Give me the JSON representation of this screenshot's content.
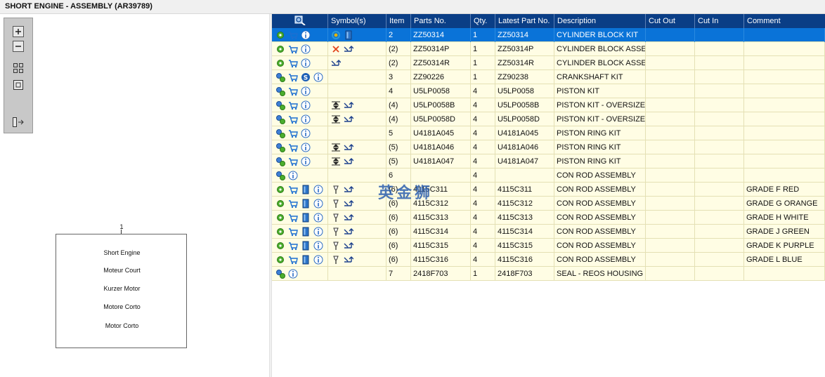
{
  "title": "SHORT ENGINE - ASSEMBLY (AR39789)",
  "diagram": {
    "callout": "1",
    "lines": [
      "Short Engine",
      "Moteur Court",
      "Kurzer Motor",
      "Motore Corto",
      "Motor Corto"
    ]
  },
  "toolbox": {
    "buttons": [
      "zoom-in",
      "zoom-out",
      "fit-all",
      "fit-page",
      "toggle-layout"
    ]
  },
  "table": {
    "headers": [
      "",
      "Symbol(s)",
      "Item",
      "Parts No.",
      "Qty.",
      "Latest Part No.",
      "Description",
      "Cut Out",
      "Cut In",
      "Comment"
    ],
    "rows": [
      {
        "icons": [
          "gear",
          "cart",
          "info"
        ],
        "symbols": [
          "gear-arrows",
          "book"
        ],
        "item": "2",
        "part": "ZZ50314",
        "qty": "1",
        "latest": "ZZ50314",
        "desc": "CYLINDER BLOCK KIT",
        "cutout": "",
        "cutin": "",
        "comment": ""
      },
      {
        "icons": [
          "gear",
          "cart",
          "info"
        ],
        "symbols": [
          "x",
          "replace"
        ],
        "item": "(2)",
        "part": "ZZ50314P",
        "qty": "1",
        "latest": "ZZ50314P",
        "desc": "CYLINDER BLOCK ASSEMBLY",
        "cutout": "",
        "cutin": "",
        "comment": ""
      },
      {
        "icons": [
          "gear",
          "cart",
          "info"
        ],
        "symbols": [
          "replace"
        ],
        "item": "(2)",
        "part": "ZZ50314R",
        "qty": "1",
        "latest": "ZZ50314R",
        "desc": "CYLINDER BLOCK ASSEMBLY",
        "cutout": "",
        "cutin": "",
        "comment": ""
      },
      {
        "icons": [
          "gears",
          "cart",
          "s",
          "info"
        ],
        "symbols": [],
        "item": "3",
        "part": "ZZ90226",
        "qty": "1",
        "latest": "ZZ90238",
        "desc": "CRANKSHAFT KIT",
        "cutout": "",
        "cutin": "",
        "comment": ""
      },
      {
        "icons": [
          "gears",
          "cart",
          "info"
        ],
        "symbols": [],
        "item": "4",
        "part": "U5LP0058",
        "qty": "4",
        "latest": "U5LP0058",
        "desc": "PISTON KIT",
        "cutout": "",
        "cutin": "",
        "comment": ""
      },
      {
        "icons": [
          "gears",
          "cart",
          "info"
        ],
        "symbols": [
          "oversize",
          "replace"
        ],
        "item": "(4)",
        "part": "U5LP0058B",
        "qty": "4",
        "latest": "U5LP0058B",
        "desc": "PISTON KIT - OVERSIZE",
        "cutout": "",
        "cutin": "",
        "comment": ""
      },
      {
        "icons": [
          "gears",
          "cart",
          "info"
        ],
        "symbols": [
          "oversize",
          "replace"
        ],
        "item": "(4)",
        "part": "U5LP0058D",
        "qty": "4",
        "latest": "U5LP0058D",
        "desc": "PISTON KIT - OVERSIZE",
        "cutout": "",
        "cutin": "",
        "comment": ""
      },
      {
        "icons": [
          "gears",
          "cart",
          "info"
        ],
        "symbols": [],
        "item": "5",
        "part": "U4181A045",
        "qty": "4",
        "latest": "U4181A045",
        "desc": "PISTON RING KIT",
        "cutout": "",
        "cutin": "",
        "comment": ""
      },
      {
        "icons": [
          "gears",
          "cart",
          "info"
        ],
        "symbols": [
          "oversize",
          "replace"
        ],
        "item": "(5)",
        "part": "U4181A046",
        "qty": "4",
        "latest": "U4181A046",
        "desc": "PISTON RING KIT",
        "cutout": "",
        "cutin": "",
        "comment": ""
      },
      {
        "icons": [
          "gears",
          "cart",
          "info"
        ],
        "symbols": [
          "oversize",
          "replace"
        ],
        "item": "(5)",
        "part": "U4181A047",
        "qty": "4",
        "latest": "U4181A047",
        "desc": "PISTON RING KIT",
        "cutout": "",
        "cutin": "",
        "comment": ""
      },
      {
        "icons": [
          "gears",
          "info"
        ],
        "symbols": [],
        "item": "6",
        "part": "",
        "qty": "4",
        "latest": "",
        "desc": "CON ROD ASSEMBLY",
        "cutout": "",
        "cutin": "",
        "comment": ""
      },
      {
        "icons": [
          "gear",
          "cart",
          "book",
          "info"
        ],
        "symbols": [
          "pin",
          "replace"
        ],
        "item": "(6)",
        "part": "4115C311",
        "qty": "4",
        "latest": "4115C311",
        "desc": "CON ROD ASSEMBLY",
        "cutout": "",
        "cutin": "",
        "comment": "GRADE F  RED"
      },
      {
        "icons": [
          "gear",
          "cart",
          "book",
          "info"
        ],
        "symbols": [
          "pin",
          "replace"
        ],
        "item": "(6)",
        "part": "4115C312",
        "qty": "4",
        "latest": "4115C312",
        "desc": "CON ROD ASSEMBLY",
        "cutout": "",
        "cutin": "",
        "comment": "GRADE G  ORANGE"
      },
      {
        "icons": [
          "gear",
          "cart",
          "book",
          "info"
        ],
        "symbols": [
          "pin",
          "replace"
        ],
        "item": "(6)",
        "part": "4115C313",
        "qty": "4",
        "latest": "4115C313",
        "desc": "CON ROD ASSEMBLY",
        "cutout": "",
        "cutin": "",
        "comment": "GRADE H  WHITE"
      },
      {
        "icons": [
          "gear",
          "cart",
          "book",
          "info"
        ],
        "symbols": [
          "pin",
          "replace"
        ],
        "item": "(6)",
        "part": "4115C314",
        "qty": "4",
        "latest": "4115C314",
        "desc": "CON ROD ASSEMBLY",
        "cutout": "",
        "cutin": "",
        "comment": "GRADE J  GREEN"
      },
      {
        "icons": [
          "gear",
          "cart",
          "book",
          "info"
        ],
        "symbols": [
          "pin",
          "replace"
        ],
        "item": "(6)",
        "part": "4115C315",
        "qty": "4",
        "latest": "4115C315",
        "desc": "CON ROD ASSEMBLY",
        "cutout": "",
        "cutin": "",
        "comment": "GRADE K  PURPLE"
      },
      {
        "icons": [
          "gear",
          "cart",
          "book",
          "info"
        ],
        "symbols": [
          "pin",
          "replace"
        ],
        "item": "(6)",
        "part": "4115C316",
        "qty": "4",
        "latest": "4115C316",
        "desc": "CON ROD ASSEMBLY",
        "cutout": "",
        "cutin": "",
        "comment": "GRADE L  BLUE"
      },
      {
        "icons": [
          "gears",
          "info"
        ],
        "symbols": [],
        "item": "7",
        "part": "2418F703",
        "qty": "1",
        "latest": "2418F703",
        "desc": "SEAL - REOS HOUSING",
        "cutout": "",
        "cutin": "",
        "comment": ""
      }
    ]
  },
  "watermark": "英金狮",
  "colors": {
    "header": "#0a3e86",
    "selected_row": "#0a73d8",
    "row_bg": "#fffde4"
  }
}
